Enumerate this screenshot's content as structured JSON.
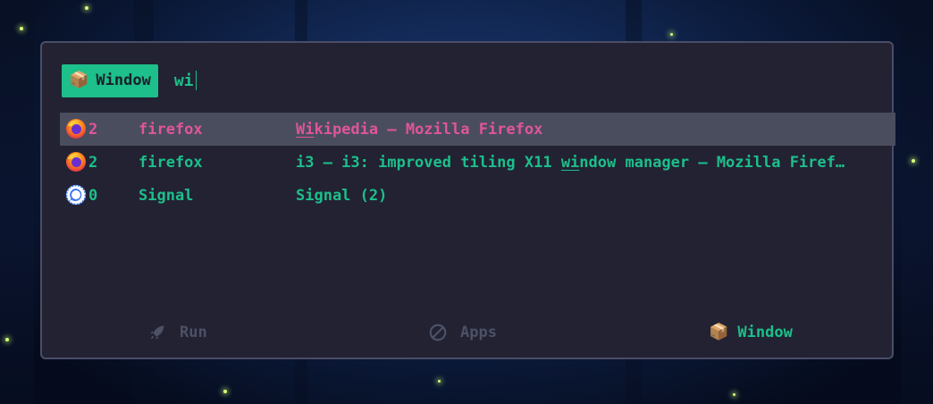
{
  "launcher": {
    "mode_badge": {
      "icon": "package-icon",
      "label": "Window"
    },
    "query": "wi"
  },
  "results": [
    {
      "icon": "firefox-icon",
      "workspace": "2",
      "class": "firefox",
      "title_match": "Wi",
      "title_rest": "kipedia — Mozilla Firefox",
      "selected": true
    },
    {
      "icon": "firefox-icon",
      "workspace": "2",
      "class": "firefox",
      "title_pre": "i3 — i3: improved tiling X11 ",
      "title_match": "wi",
      "title_post": "ndow manager — Mozilla Firef…",
      "selected": false
    },
    {
      "icon": "signal-icon",
      "workspace": "0",
      "class": "Signal",
      "title": "Signal (2)",
      "selected": false
    }
  ],
  "modes": [
    {
      "icon": "rocket-icon",
      "label": "Run",
      "active": false
    },
    {
      "icon": "ban-icon",
      "label": "Apps",
      "active": false
    },
    {
      "icon": "package-icon",
      "label": "Window",
      "active": true
    }
  ],
  "colors": {
    "accent": "#1dbf8a",
    "selected_text": "#e0559a",
    "selected_bg": "#4a4d5e",
    "panel_bg": "#222233",
    "inactive": "#4c5166"
  }
}
